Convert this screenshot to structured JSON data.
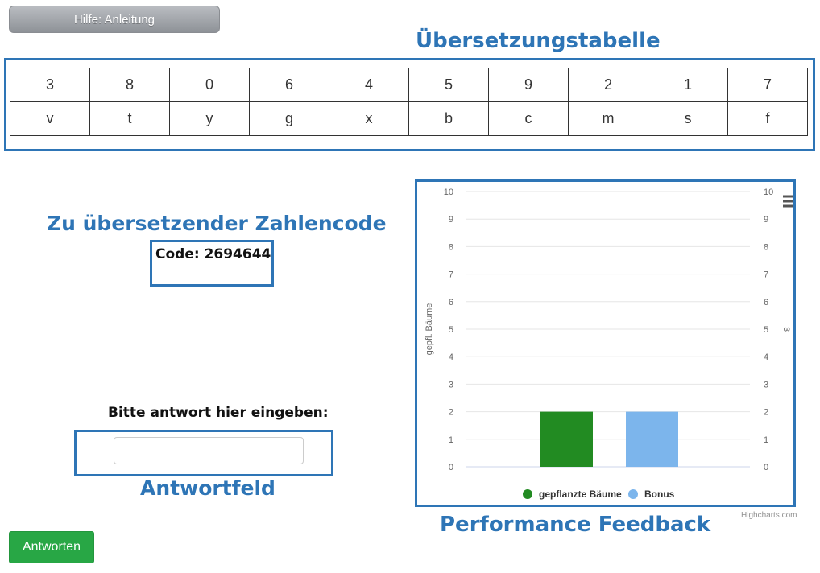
{
  "header": {
    "help_button_label": "Hilfe: Anleitung"
  },
  "annotations": {
    "table_title": "Übersetzungstabelle",
    "code_title": "Zu übersetzender Zahlencode",
    "answer_title": "Antwortfeld",
    "performance_title": "Performance Feedback"
  },
  "translation_table": {
    "digits": [
      "3",
      "8",
      "0",
      "6",
      "4",
      "5",
      "9",
      "2",
      "1",
      "7"
    ],
    "letters": [
      "v",
      "t",
      "y",
      "g",
      "x",
      "b",
      "c",
      "m",
      "s",
      "f"
    ]
  },
  "code": {
    "text": "Code: 2694644"
  },
  "answer": {
    "prompt": "Bitte antwort hier eingeben:",
    "value": "",
    "placeholder": ""
  },
  "submit": {
    "label": "Antworten"
  },
  "chart_data": {
    "type": "bar",
    "ylabel": "gepfl. Bäume",
    "ylabel_right": "3",
    "ylim": [
      0,
      10
    ],
    "yticks": [
      "0",
      "1",
      "2",
      "3",
      "4",
      "5",
      "6",
      "7",
      "8",
      "9",
      "10"
    ],
    "grid": true,
    "legend_position": "bottom-center",
    "series": [
      {
        "name": "gepflanzte Bäume",
        "values": [
          2
        ],
        "color": "#228b22"
      },
      {
        "name": "Bonus",
        "values": [
          2
        ],
        "color": "#7cb5ec"
      }
    ],
    "menu_icon": "hamburger-menu-icon",
    "credits": "Highcharts.com"
  }
}
